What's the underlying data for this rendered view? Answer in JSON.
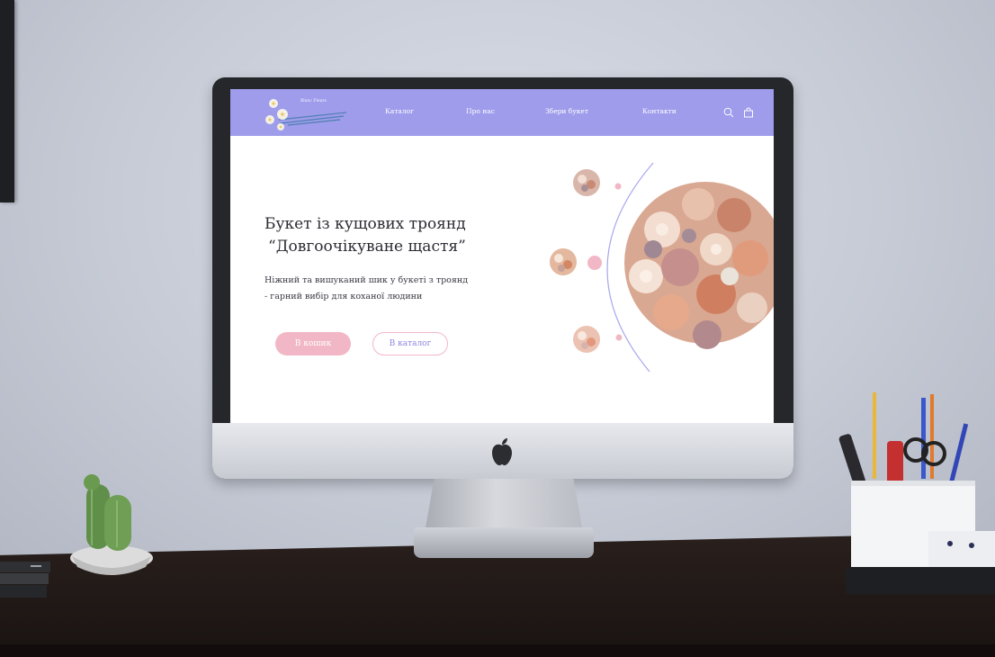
{
  "site": {
    "brand": "Blanc Fleurs",
    "nav": [
      {
        "label": "Каталог"
      },
      {
        "label": "Про нас"
      },
      {
        "label": "Збери букет"
      },
      {
        "label": "Контакти"
      }
    ],
    "hero": {
      "title_line1": "Букет із кущових троянд",
      "title_line2": "“Довгоочікуване щастя”",
      "description": "Ніжний та вишуканий шик у букеті з троянд - гарний вибір для коханої людини",
      "button_cart": "В кошик",
      "button_catalog": "В каталог"
    },
    "carousel": {
      "thumbnails": 3,
      "active_index": 1
    }
  },
  "colors": {
    "header": "#9e9ceb",
    "accent_pink": "#f2b7c6",
    "accent_purple": "#8b86e0"
  },
  "icons": [
    "search-icon",
    "shopping-bag-icon",
    "flower-logo-icon",
    "apple-logo-icon"
  ]
}
